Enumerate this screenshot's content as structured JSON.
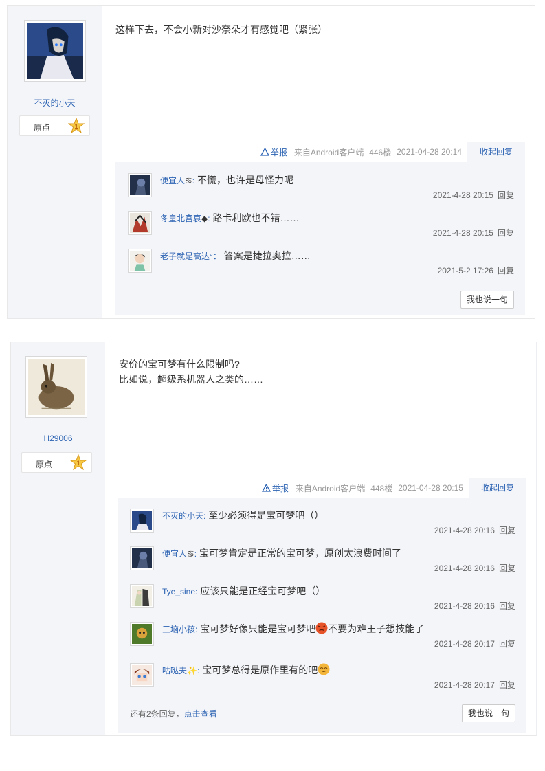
{
  "posts": [
    {
      "author": "不灭的小天",
      "level_label": "原点",
      "level_number": "1",
      "text_lines": [
        "这样下去，不会小新对沙奈朵才有感觉吧（紧张）"
      ],
      "tail": {
        "report": "举报",
        "source": "来自Android客户端",
        "floor": "446楼",
        "time": "2021-04-28 20:14",
        "collapse": "收起回复"
      },
      "replies": [
        {
          "user": "便宜人",
          "sep": ":",
          "text": "不慌，也许是母怪力呢",
          "time": "2021-4-28 20:15",
          "reply_label": "回复",
          "badge": "♋"
        },
        {
          "user": "冬皇北宫哀",
          "sep": ":",
          "text": "路卡利欧也不错……",
          "time": "2021-4-28 20:15",
          "reply_label": "回复",
          "badge": "◆"
        },
        {
          "user": "老子就是高达",
          "sep": "°：",
          "text": "答案是捷拉奥拉……",
          "time": "2021-5-2 17:26",
          "reply_label": "回复",
          "badge": ""
        }
      ],
      "say_button": "我也说一句"
    },
    {
      "author": "H29006",
      "level_label": "原点",
      "level_number": "1",
      "text_lines": [
        "安价的宝可梦有什么限制吗?",
        "比如说，超级系机器人之类的……"
      ],
      "tail": {
        "report": "举报",
        "source": "来自Android客户端",
        "floor": "448楼",
        "time": "2021-04-28 20:15",
        "collapse": "收起回复"
      },
      "replies": [
        {
          "user": "不灭的小天",
          "sep": ":",
          "text": "至少必须得是宝可梦吧（）",
          "time": "2021-4-28 20:16",
          "reply_label": "回复",
          "badge": ""
        },
        {
          "user": "便宜人",
          "sep": ":",
          "text": "宝可梦肯定是正常的宝可梦，原创太浪费时间了",
          "time": "2021-4-28 20:16",
          "reply_label": "回复",
          "badge": "♋"
        },
        {
          "user": "Tye_sine",
          "sep": ":",
          "text": "应该只能是正经宝可梦吧（）",
          "time": "2021-4-28 20:16",
          "reply_label": "回复",
          "badge": ""
        },
        {
          "user": "三垴小孩",
          "sep": ":",
          "text": "宝可梦好像只能是宝可梦吧",
          "text2": "不要为难王子想技能了",
          "time": "2021-4-28 20:17",
          "reply_label": "回复",
          "badge": ""
        },
        {
          "user": "咕哒夫",
          "sep": ":",
          "text": "宝可梦总得是原作里有的吧",
          "time": "2021-4-28 20:17",
          "reply_label": "回复",
          "badge": "✨"
        }
      ],
      "more_replies": "还有2条回复，",
      "more_link": "点击查看",
      "say_button": "我也说一句"
    }
  ],
  "colors": {
    "link": "#2d64b3",
    "panel": "#f4f5f9",
    "meta": "#999999"
  },
  "icons": [
    "warning-icon",
    "level-star-icon",
    "emoji-angry-icon",
    "emoji-grin-icon"
  ]
}
